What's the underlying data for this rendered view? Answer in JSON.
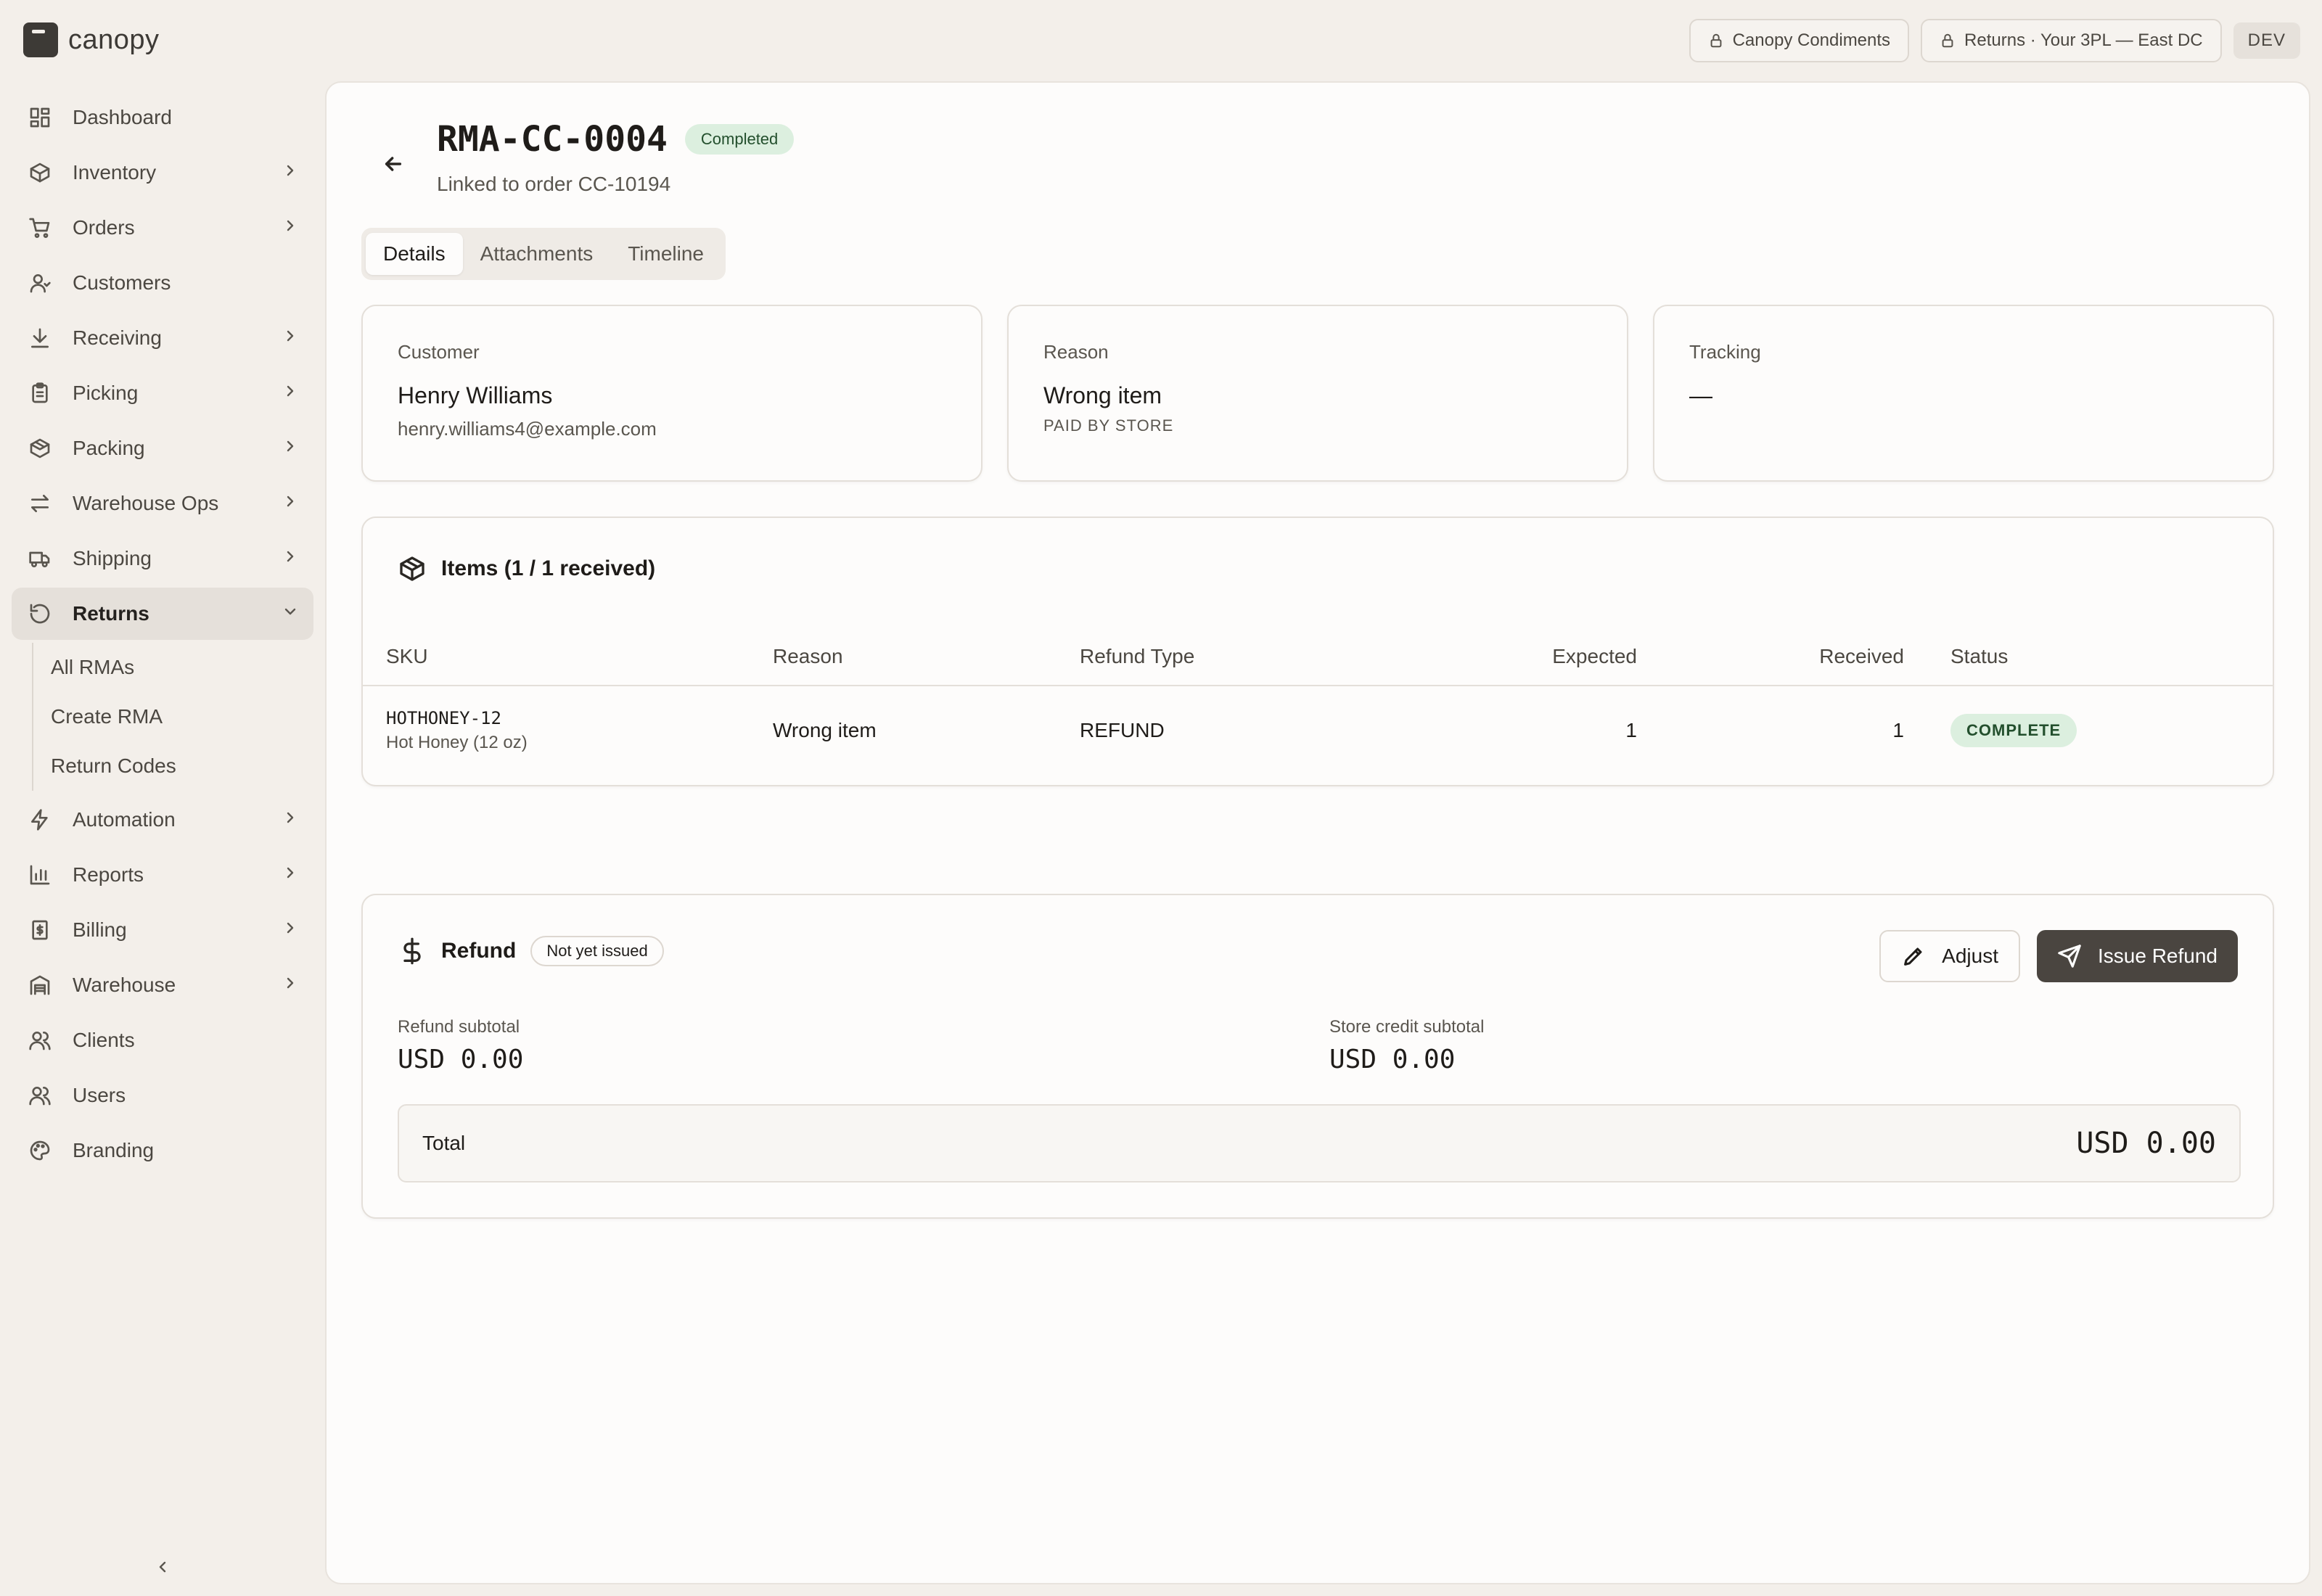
{
  "brand": {
    "name": "canopy"
  },
  "topbar": {
    "client": "Canopy Condiments",
    "context": "Returns · Your 3PL — East DC",
    "env": "DEV"
  },
  "sidebar": {
    "items": [
      {
        "label": "Dashboard",
        "icon": "dashboard-icon"
      },
      {
        "label": "Inventory",
        "icon": "box-icon"
      },
      {
        "label": "Orders",
        "icon": "cart-icon"
      },
      {
        "label": "Customers",
        "icon": "user-icon"
      },
      {
        "label": "Receiving",
        "icon": "download-icon"
      },
      {
        "label": "Picking",
        "icon": "clipboard-icon"
      },
      {
        "label": "Packing",
        "icon": "package-icon"
      },
      {
        "label": "Warehouse Ops",
        "icon": "arrows-icon"
      },
      {
        "label": "Shipping",
        "icon": "truck-icon"
      },
      {
        "label": "Returns",
        "icon": "rotate-icon"
      },
      {
        "label": "Automation",
        "icon": "bolt-icon"
      },
      {
        "label": "Reports",
        "icon": "bar-chart-icon"
      },
      {
        "label": "Billing",
        "icon": "receipt-icon"
      },
      {
        "label": "Warehouse",
        "icon": "warehouse-icon"
      },
      {
        "label": "Clients",
        "icon": "users-icon"
      },
      {
        "label": "Users",
        "icon": "users-icon"
      },
      {
        "label": "Branding",
        "icon": "palette-icon"
      }
    ],
    "returns_sub": [
      "All RMAs",
      "Create RMA",
      "Return Codes"
    ]
  },
  "header": {
    "title": "RMA-CC-0004",
    "status": "Completed",
    "subtitle": "Linked to order CC-10194"
  },
  "tabs": [
    "Details",
    "Attachments",
    "Timeline"
  ],
  "customer": {
    "label": "Customer",
    "name": "Henry Williams",
    "email": "henry.williams4@example.com"
  },
  "reason": {
    "label": "Reason",
    "value": "Wrong item",
    "paid_by": "PAID BY STORE"
  },
  "tracking": {
    "label": "Tracking",
    "value": "—"
  },
  "items": {
    "title": "Items (1 / 1 received)",
    "columns": [
      "SKU",
      "Reason",
      "Refund Type",
      "Expected",
      "Received",
      "Status"
    ],
    "rows": [
      {
        "sku": "HOTHONEY-12",
        "name": "Hot Honey (12 oz)",
        "reason": "Wrong item",
        "refund_type": "REFUND",
        "expected": "1",
        "received": "1",
        "status": "COMPLETE"
      }
    ]
  },
  "refund": {
    "title": "Refund",
    "status": "Not yet issued",
    "adjust_label": "Adjust",
    "issue_label": "Issue Refund",
    "refund_subtotal_label": "Refund subtotal",
    "refund_subtotal": "USD 0.00",
    "store_credit_label": "Store credit subtotal",
    "store_credit": "USD 0.00",
    "total_label": "Total",
    "total": "USD 0.00"
  },
  "colors": {
    "accent": "#4a4540",
    "success_bg": "#dcefdf",
    "success_text": "#234f2d"
  }
}
